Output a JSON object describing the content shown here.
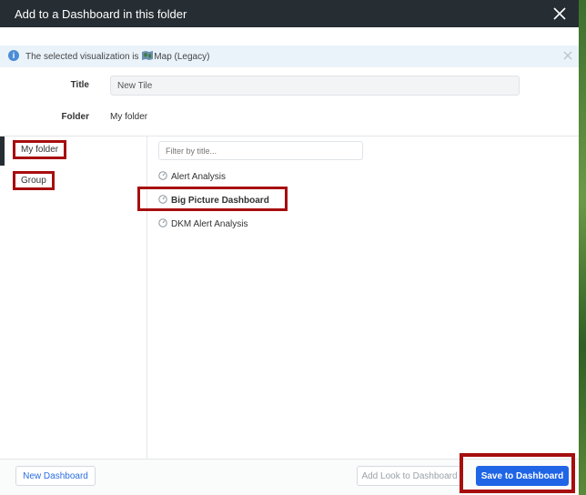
{
  "modal": {
    "title": "Add to a Dashboard in this folder"
  },
  "info": {
    "prefix": "The selected visualization is",
    "visualization": "Map (Legacy)"
  },
  "form": {
    "title_label": "Title",
    "title_value": "New Tile",
    "folder_label": "Folder",
    "folder_value": "My folder"
  },
  "folders": [
    {
      "label": "My folder",
      "selected": true
    },
    {
      "label": "Group",
      "selected": false
    }
  ],
  "filter": {
    "placeholder": "Filter by title..."
  },
  "dashboards": [
    {
      "label": "Alert Analysis",
      "selected": false
    },
    {
      "label": "Big Picture Dashboard",
      "selected": true
    },
    {
      "label": "DKM Alert Analysis",
      "selected": false
    }
  ],
  "footer": {
    "new_dashboard_label": "New Dashboard",
    "add_look_label": "Add Look to Dashboard",
    "save_label": "Save to Dashboard"
  },
  "colors": {
    "header_bg": "#262d33",
    "primary_button": "#1f65e6",
    "annotation_box": "#a70e0e",
    "info_bar_bg": "#eaf3fa"
  },
  "icons": {
    "close": "close-icon",
    "info": "info-icon",
    "map": "map-icon",
    "dashboard": "dashboard-icon"
  }
}
